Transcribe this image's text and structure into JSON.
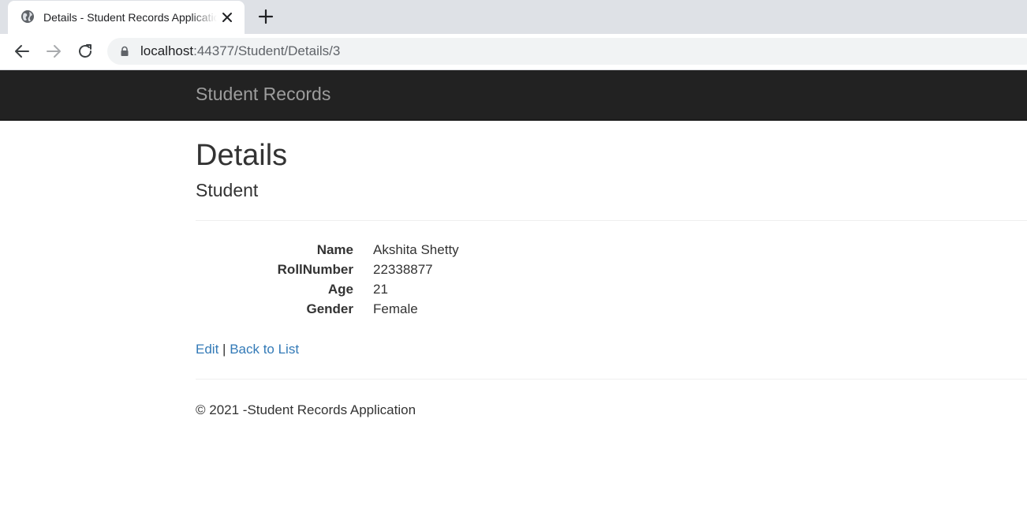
{
  "browser": {
    "tab": {
      "title": "Details - Student Records Application"
    },
    "url": {
      "host": "localhost",
      "path": ":44377/Student/Details/3"
    }
  },
  "navbar": {
    "brand": "Student Records"
  },
  "page": {
    "title": "Details",
    "subtitle": "Student",
    "fields": [
      {
        "label": "Name",
        "value": "Akshita Shetty"
      },
      {
        "label": "RollNumber",
        "value": "22338877"
      },
      {
        "label": "Age",
        "value": "21"
      },
      {
        "label": "Gender",
        "value": "Female"
      }
    ],
    "actions": {
      "edit": "Edit",
      "separator": "|",
      "back": "Back to List"
    }
  },
  "footer": {
    "text": "© 2021 -Student Records Application"
  }
}
